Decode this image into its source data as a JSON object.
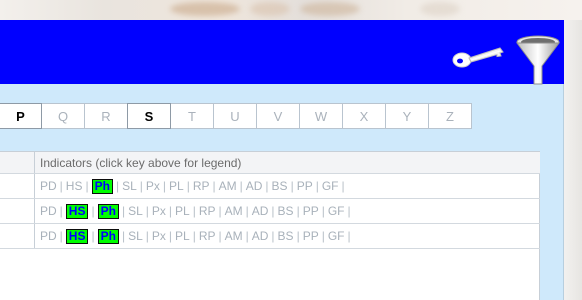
{
  "toolbar": {
    "key_icon": "key-icon",
    "filter_icon": "funnel-filter-icon"
  },
  "letters": [
    {
      "label": "P",
      "active": true
    },
    {
      "label": "Q",
      "active": false
    },
    {
      "label": "R",
      "active": false
    },
    {
      "label": "S",
      "active": true
    },
    {
      "label": "T",
      "active": false
    },
    {
      "label": "U",
      "active": false
    },
    {
      "label": "V",
      "active": false
    },
    {
      "label": "W",
      "active": false
    },
    {
      "label": "X",
      "active": false
    },
    {
      "label": "Y",
      "active": false
    },
    {
      "label": "Z",
      "active": false
    }
  ],
  "table": {
    "header": "Indicators (click key above for legend)",
    "rows": [
      {
        "indicators": [
          {
            "code": "PD",
            "on": false
          },
          {
            "code": "HS",
            "on": false
          },
          {
            "code": "Ph",
            "on": true
          },
          {
            "code": "SL",
            "on": false
          },
          {
            "code": "Px",
            "on": false
          },
          {
            "code": "PL",
            "on": false
          },
          {
            "code": "RP",
            "on": false
          },
          {
            "code": "AM",
            "on": false
          },
          {
            "code": "AD",
            "on": false
          },
          {
            "code": "BS",
            "on": false
          },
          {
            "code": "PP",
            "on": false
          },
          {
            "code": "GF",
            "on": false
          }
        ]
      },
      {
        "indicators": [
          {
            "code": "PD",
            "on": false
          },
          {
            "code": "HS",
            "on": true
          },
          {
            "code": "Ph",
            "on": true
          },
          {
            "code": "SL",
            "on": false
          },
          {
            "code": "Px",
            "on": false
          },
          {
            "code": "PL",
            "on": false
          },
          {
            "code": "RP",
            "on": false
          },
          {
            "code": "AM",
            "on": false
          },
          {
            "code": "AD",
            "on": false
          },
          {
            "code": "BS",
            "on": false
          },
          {
            "code": "PP",
            "on": false
          },
          {
            "code": "GF",
            "on": false
          }
        ]
      },
      {
        "indicators": [
          {
            "code": "PD",
            "on": false
          },
          {
            "code": "HS",
            "on": true
          },
          {
            "code": "Ph",
            "on": true
          },
          {
            "code": "SL",
            "on": false
          },
          {
            "code": "Px",
            "on": false
          },
          {
            "code": "PL",
            "on": false
          },
          {
            "code": "RP",
            "on": false
          },
          {
            "code": "AM",
            "on": false
          },
          {
            "code": "AD",
            "on": false
          },
          {
            "code": "BS",
            "on": false
          },
          {
            "code": "PP",
            "on": false
          },
          {
            "code": "GF",
            "on": false
          }
        ]
      }
    ]
  },
  "colors": {
    "header_bar": "#0000ff",
    "panel_bg": "#cfe9fb",
    "highlight_bg": "#00ff00",
    "highlight_text": "#0000ff",
    "inactive_text": "#a8b1ba"
  }
}
